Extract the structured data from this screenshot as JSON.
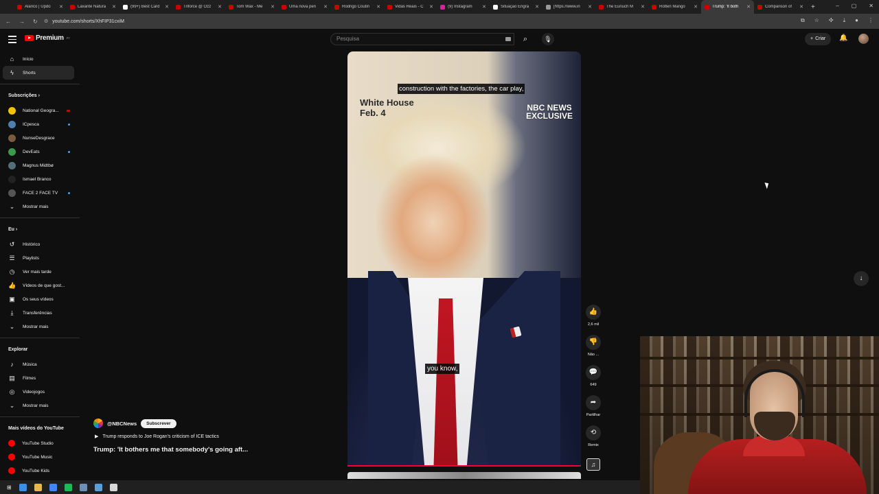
{
  "browser": {
    "tabs": [
      {
        "title": "Alarico | Updo",
        "color": "#cc0000"
      },
      {
        "title": "Laxante Natura",
        "color": "#cc0000"
      },
      {
        "title": "(99+) Best Card",
        "color": "#ffffff"
      },
      {
        "title": "Triforce @ Ozz",
        "color": "#cc0000"
      },
      {
        "title": "Tom Wax - Me",
        "color": "#cc0000"
      },
      {
        "title": "Uma nova pen",
        "color": "#cc0000"
      },
      {
        "title": "Rodrigo Coutin",
        "color": "#cc0000"
      },
      {
        "title": "Vidas Reais - C",
        "color": "#cc0000"
      },
      {
        "title": "(9) Instagram",
        "color": "#d6249f"
      },
      {
        "title": "Situação Engra",
        "color": "#ffffff"
      },
      {
        "title": "[https://www.in",
        "color": "#999999"
      },
      {
        "title": "The Eunuch M",
        "color": "#cc0000"
      },
      {
        "title": "Rotten Mango",
        "color": "#cc0000"
      },
      {
        "title": "Trump: 'It both",
        "color": "#cc0000"
      },
      {
        "title": "Comparison of",
        "color": "#cc0000"
      }
    ],
    "active_tab": 13,
    "url": "youtube.com/shorts/XhFIP31cxiM"
  },
  "header": {
    "logo_text": "Premium",
    "logo_sup": "PT",
    "search_placeholder": "Pesquisa",
    "create_label": "Criar"
  },
  "sidebar": {
    "main": [
      {
        "label": "Início",
        "icon": "⌂",
        "active": false
      },
      {
        "label": "Shorts",
        "icon": "ϟ",
        "active": true
      }
    ],
    "subs_header": "Subscrições",
    "subs": [
      {
        "label": "National Geogra...",
        "color": "#f2c200",
        "mark": "live"
      },
      {
        "label": "ICpesca",
        "color": "#4f7fae",
        "mark": "dot"
      },
      {
        "label": "NunseDesgrace",
        "color": "#7a5b3f",
        "mark": "none"
      },
      {
        "label": "DevEats",
        "color": "#3c9a4a",
        "mark": "dot"
      },
      {
        "label": "Magnus Midtbø",
        "color": "#546e7a",
        "mark": "none"
      },
      {
        "label": "Ismael Branco",
        "color": "#222222",
        "mark": "none"
      },
      {
        "label": "FACE 2 FACE TV",
        "color": "#555555",
        "mark": "dot"
      }
    ],
    "subs_more": "Mostrar mais",
    "you_header": "Eu",
    "you": [
      {
        "label": "Histórico",
        "icon": "↺"
      },
      {
        "label": "Playlists",
        "icon": "☰"
      },
      {
        "label": "Ver mais tarde",
        "icon": "◷"
      },
      {
        "label": "Vídeos de que gost...",
        "icon": "👍"
      },
      {
        "label": "Os seus vídeos",
        "icon": "▣"
      },
      {
        "label": "Transferências",
        "icon": "⤓"
      }
    ],
    "you_more": "Mostrar mais",
    "explore_header": "Explorar",
    "explore": [
      {
        "label": "Música",
        "icon": "♪"
      },
      {
        "label": "Filmes",
        "icon": "▤"
      },
      {
        "label": "Videojogos",
        "icon": "◎"
      }
    ],
    "explore_more": "Mostrar mais",
    "more_header": "Mais vídeos do YouTube",
    "more": [
      {
        "label": "YouTube Studio"
      },
      {
        "label": "YouTube Music"
      },
      {
        "label": "YouTube Kids"
      }
    ]
  },
  "video": {
    "overlay_location": "White House",
    "overlay_date": "Feb. 4",
    "badge_line1": "NBC NEWS",
    "badge_line2": "EXCLUSIVE",
    "caption_top": "construction with the factories, the car play,",
    "caption_bottom": "you know,",
    "progress": 0.99
  },
  "info": {
    "channel": "@NBCNews",
    "subscribe_label": "Subscrever",
    "related_label": "Trump responds to Joe Rogan's criticism of ICE tactics",
    "title": "Trump: 'It bothers me that somebody's going aft..."
  },
  "actions": {
    "likes": "2,6 mil",
    "dislike_label": "Não ...",
    "comments": "649",
    "share_label": "Partilhar",
    "remix_label": "Remix"
  },
  "taskbar": {
    "apps": [
      "#3b8eea",
      "#e8b84a",
      "#4285f4",
      "#1db954",
      "#6d8fb5",
      "#5aa0d8",
      "#d8d8d8"
    ]
  }
}
